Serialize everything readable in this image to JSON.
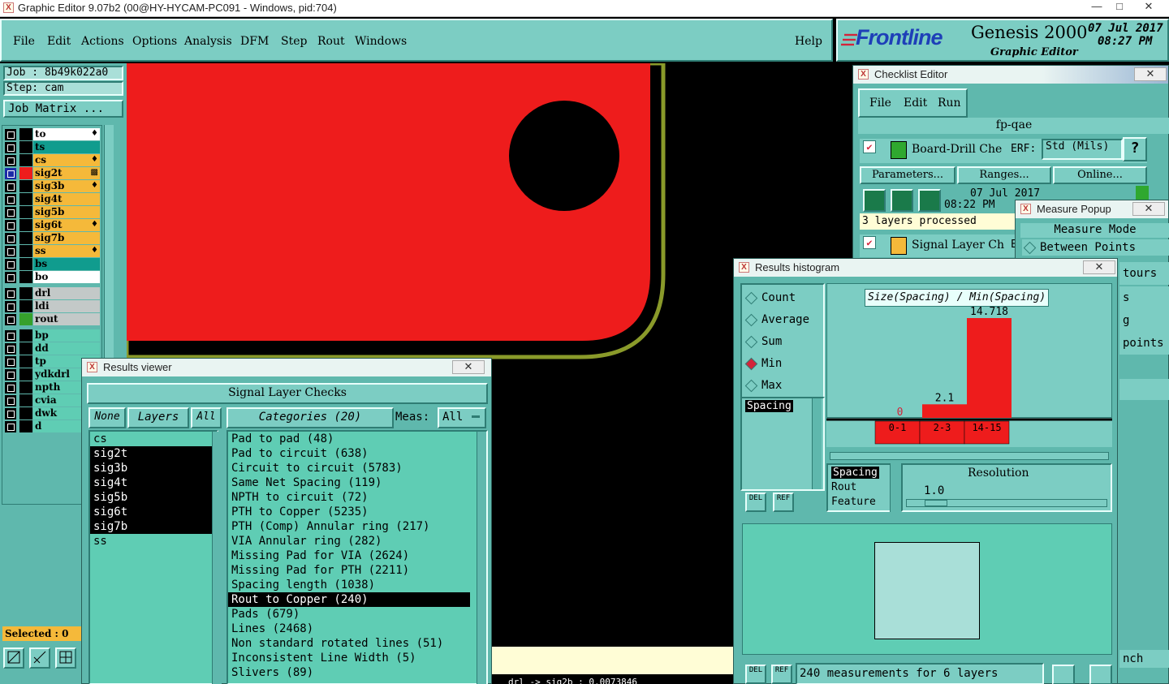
{
  "window": {
    "title": "Graphic Editor 9.07b2 (00@HY-HYCAM-PC091 - Windows, pid:704)",
    "min": "—",
    "max": "□",
    "close": "✕"
  },
  "menu": [
    "File",
    "Edit",
    "Actions",
    "Options",
    "Analysis",
    "DFM",
    "Step",
    "Rout",
    "Windows"
  ],
  "help": "Help",
  "brand": {
    "logo": "Frontline",
    "product": "Genesis 2000",
    "sub": "Graphic Editor",
    "date": "07 Jul 2017",
    "time": "08:27 PM"
  },
  "side": {
    "job": "Job : 8b49k022a0",
    "step": "Step: cam",
    "matrix_btn": "Job Matrix ...",
    "selected": "Selected : 0",
    "layers_group1": [
      {
        "name": "to",
        "bg": "#ffffff",
        "icon": "♦"
      },
      {
        "name": "ts",
        "bg": "#109c8e",
        "icon": ""
      },
      {
        "name": "cs",
        "bg": "#f5b93a",
        "icon": "♦"
      },
      {
        "name": "sig2t",
        "bg": "#f5b93a",
        "icon": "▩",
        "active": true
      },
      {
        "name": "sig3b",
        "bg": "#f5b93a",
        "icon": "♦"
      },
      {
        "name": "sig4t",
        "bg": "#f5b93a",
        "icon": ""
      },
      {
        "name": "sig5b",
        "bg": "#f5b93a",
        "icon": ""
      },
      {
        "name": "sig6t",
        "bg": "#f5b93a",
        "icon": "♦"
      },
      {
        "name": "sig7b",
        "bg": "#f5b93a",
        "icon": ""
      },
      {
        "name": "ss",
        "bg": "#f5b93a",
        "icon": "♦"
      },
      {
        "name": "bs",
        "bg": "#109c8e",
        "icon": ""
      },
      {
        "name": "bo",
        "bg": "#ffffff",
        "icon": ""
      }
    ],
    "layers_group2": [
      {
        "name": "drl",
        "bg": "#c3c9c8"
      },
      {
        "name": "ldi",
        "bg": "#c3c9c8"
      },
      {
        "name": "rout",
        "bg": "#c3c9c8",
        "swatch": "#36a02c"
      }
    ],
    "layers_group3": [
      "bp",
      "dd",
      "tp",
      "ydkdrl",
      "npth",
      "cvia",
      "dwk",
      "d"
    ]
  },
  "checklist": {
    "title": "Checklist Editor",
    "menu": [
      "File",
      "Edit",
      "Run"
    ],
    "name": "fp-qae",
    "item1": "Board-Drill Che",
    "erf_label": "ERF:",
    "std": "Std (Mils)",
    "q": "?",
    "params": "Parameters...",
    "ranges": "Ranges...",
    "online": "Online...",
    "date": "07 Jul 2017",
    "time": "08:22 PM",
    "processed": "3 layers processed",
    "item2": "Signal Layer Ch",
    "erf2": "ER",
    "q2": "?",
    "q3": "?",
    "excl": "!!"
  },
  "measure": {
    "title": "Measure Popup",
    "mode": "Measure Mode",
    "opts": [
      "Between Points",
      "tours",
      "s",
      "g",
      "points"
    ],
    "bottom": "nch"
  },
  "results_viewer": {
    "title": "Results viewer",
    "heading": "Signal Layer Checks",
    "none": "None",
    "layers": "Layers",
    "all": "All",
    "categories": "Categories (20)",
    "meas_label": "Meas:",
    "meas_value": "All",
    "layer_list": [
      {
        "name": "cs",
        "sel": false
      },
      {
        "name": "sig2t",
        "sel": true
      },
      {
        "name": "sig3b",
        "sel": true
      },
      {
        "name": "sig4t",
        "sel": true
      },
      {
        "name": "sig5b",
        "sel": true
      },
      {
        "name": "sig6t",
        "sel": true
      },
      {
        "name": "sig7b",
        "sel": true
      },
      {
        "name": "ss",
        "sel": false
      }
    ],
    "category_list": [
      {
        "name": "Pad to pad (48)",
        "sel": false
      },
      {
        "name": "Pad to circuit (638)",
        "sel": false
      },
      {
        "name": "Circuit to circuit (5783)",
        "sel": false
      },
      {
        "name": "Same Net Spacing (119)",
        "sel": false
      },
      {
        "name": "NPTH to circuit (72)",
        "sel": false
      },
      {
        "name": "PTH to Copper (5235)",
        "sel": false
      },
      {
        "name": "PTH (Comp) Annular ring (217)",
        "sel": false
      },
      {
        "name": "VIA Annular ring (282)",
        "sel": false
      },
      {
        "name": "Missing Pad for VIA (2624)",
        "sel": false
      },
      {
        "name": "Missing Pad for PTH (2211)",
        "sel": false
      },
      {
        "name": "Spacing length (1038)",
        "sel": false
      },
      {
        "name": "Rout to Copper (240)",
        "sel": true
      },
      {
        "name": "Pads (679)",
        "sel": false
      },
      {
        "name": "Lines (2468)",
        "sel": false
      },
      {
        "name": "Non standard rotated lines (51)",
        "sel": false
      },
      {
        "name": "Inconsistent Line Width (5)",
        "sel": false
      },
      {
        "name": "Slivers (89)",
        "sel": false
      }
    ]
  },
  "histogram": {
    "title": "Results histogram",
    "modes": [
      {
        "name": "Count",
        "on": false
      },
      {
        "name": "Average",
        "on": false
      },
      {
        "name": "Sum",
        "on": false
      },
      {
        "name": "Min",
        "on": true
      },
      {
        "name": "Max",
        "on": false
      }
    ],
    "measure_list": [
      "Spacing"
    ],
    "del": "DEL",
    "ref": "REF",
    "plot_title": "Size(Spacing) / Min(Spacing)",
    "resolution_label": "Resolution",
    "resolution_value": "1.0",
    "fields": [
      "Spacing",
      "Rout",
      "Feature"
    ],
    "status": "240 measurements for 6 layers"
  },
  "chart_data": {
    "type": "bar",
    "title": "Size(Spacing) / Min(Spacing)",
    "categories": [
      "0-1",
      "2-3",
      "14-15"
    ],
    "values": [
      0,
      2.1,
      14.718
    ],
    "labels": [
      "0",
      "2.1",
      "14.718"
    ],
    "ylim": [
      0,
      14.718
    ],
    "color": "#ee1c1c"
  },
  "statusline": "drl -> sig2b : 0.0073846",
  "colors": {
    "panel": "#5fb8ad",
    "board": "#ee1c1c",
    "bar": "#ee1c1c",
    "accent": "#d3243a"
  }
}
